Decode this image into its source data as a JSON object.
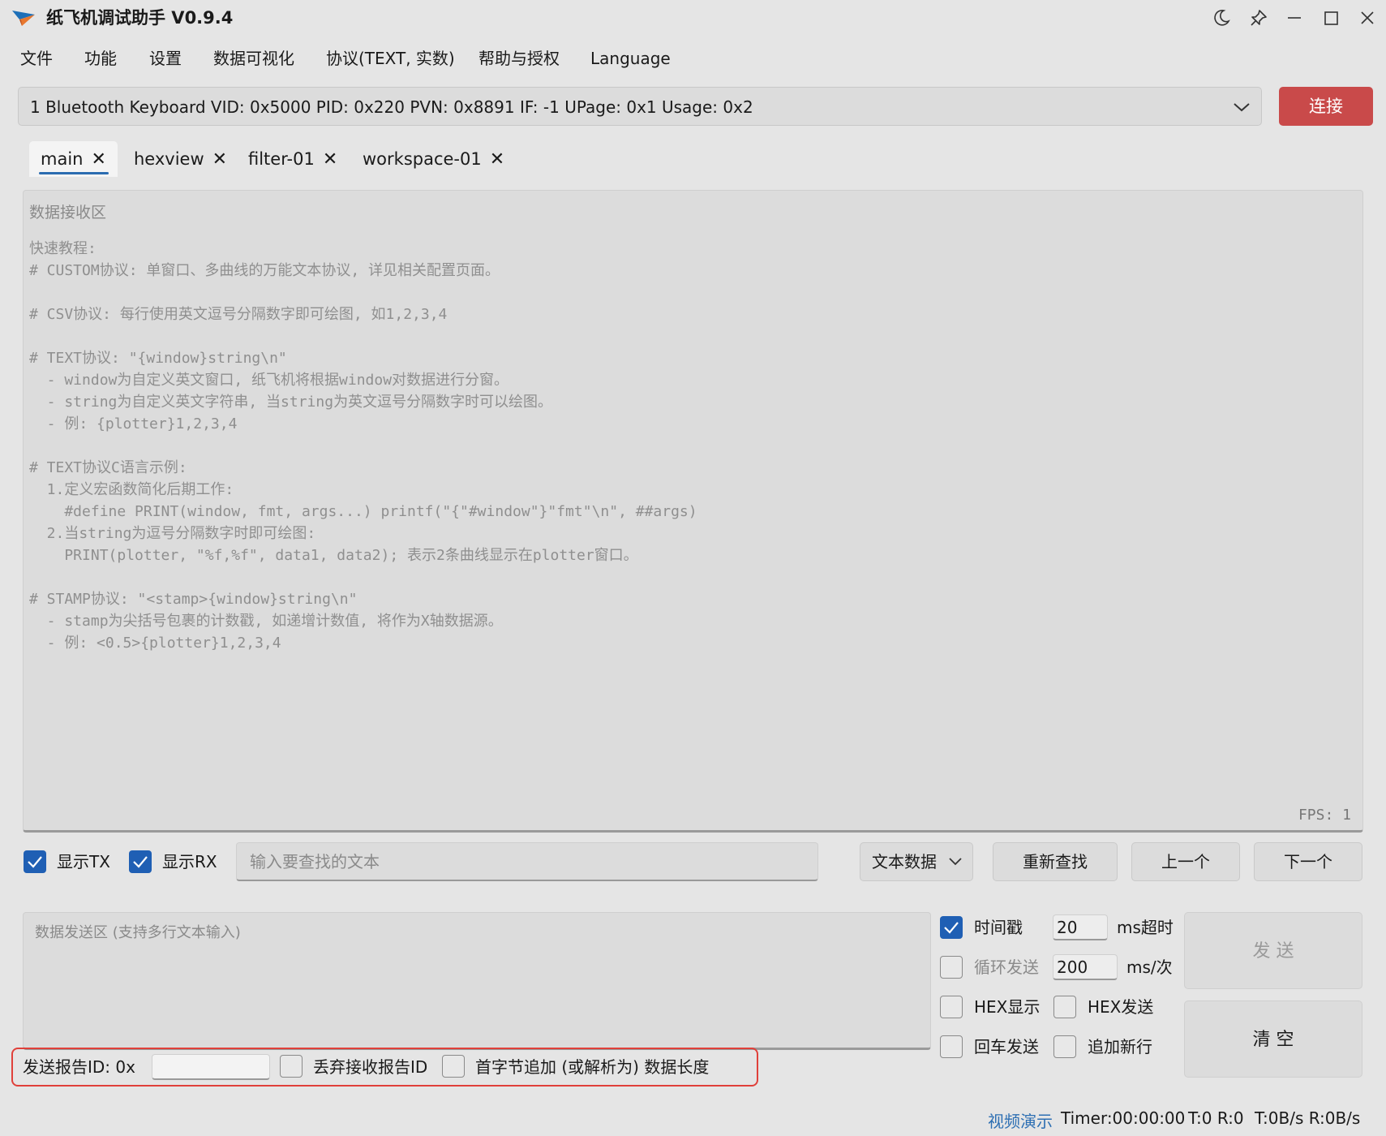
{
  "window": {
    "title": "纸飞机调试助手 V0.9.4"
  },
  "menu": [
    "文件",
    "功能",
    "设置",
    "数据可视化",
    "协议(TEXT, 实数)",
    "帮助与授权",
    "Language"
  ],
  "device": {
    "selected": "1 Bluetooth Keyboard VID: 0x5000 PID: 0x220 PVN: 0x8891 IF: -1 UPage: 0x1 Usage: 0x2",
    "connect_label": "连接",
    "connect_color": "#c94a4a"
  },
  "tabs": [
    {
      "label": "main",
      "active": true
    },
    {
      "label": "hexview",
      "active": false
    },
    {
      "label": "filter-01",
      "active": false
    },
    {
      "label": "workspace-01",
      "active": false
    }
  ],
  "receive": {
    "title": "数据接收区",
    "lines": [
      "快速教程:",
      "# CUSTOM协议: 单窗口、多曲线的万能文本协议, 详见相关配置页面。",
      "",
      "# CSV协议: 每行使用英文逗号分隔数字即可绘图, 如1,2,3,4",
      "",
      "# TEXT协议: \"{window}string\\n\"",
      "  - window为自定义英文窗口, 纸飞机将根据window对数据进行分窗。",
      "  - string为自定义英文字符串, 当string为英文逗号分隔数字时可以绘图。",
      "  - 例: {plotter}1,2,3,4",
      "",
      "# TEXT协议C语言示例:",
      "  1.定义宏函数简化后期工作:",
      "    #define PRINT(window, fmt, args...) printf(\"{\"#window\"}\"fmt\"\\n\", ##args)",
      "  2.当string为逗号分隔数字时即可绘图:",
      "    PRINT(plotter, \"%f,%f\", data1, data2); 表示2条曲线显示在plotter窗口。",
      "",
      "# STAMP协议: \"<stamp>{window}string\\n\"",
      "  - stamp为尖括号包裹的计数戳, 如递增计数值, 将作为X轴数据源。",
      "  - 例: <0.5>{plotter}1,2,3,4"
    ],
    "fps": "FPS: 1"
  },
  "search": {
    "show_tx_label": "显示TX",
    "show_tx": true,
    "show_rx_label": "显示RX",
    "show_rx": true,
    "placeholder": "输入要查找的文本",
    "mode": "文本数据",
    "research_label": "重新查找",
    "prev_label": "上一个",
    "next_label": "下一个"
  },
  "send": {
    "placeholder": "数据发送区 (支持多行文本输入)",
    "timestamp_label": "时间戳",
    "timestamp": true,
    "timeout_value": "20",
    "timeout_unit": "ms超时",
    "loop_label": "循环发送",
    "loop": false,
    "interval_value": "200",
    "interval_unit": "ms/次",
    "hex_show_label": "HEX显示",
    "hex_send_label": "HEX发送",
    "enter_send_label": "回车发送",
    "append_newline_label": "追加新行",
    "send_label": "发 送",
    "clear_label": "清 空"
  },
  "report": {
    "send_id_label": "发送报告ID: 0x",
    "send_id_value": "",
    "drop_id_label": "丢弃接收报告ID",
    "length_label": "首字节追加 (或解析为) 数据长度"
  },
  "status": {
    "video": "视频演示",
    "timer": "Timer:00:00:00",
    "tr": "T:0 R:0",
    "rate": "T:0B/s R:0B/s"
  }
}
